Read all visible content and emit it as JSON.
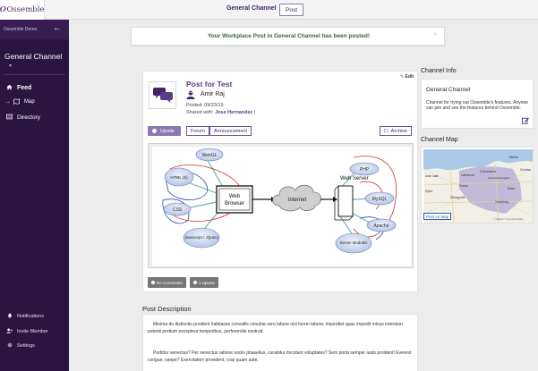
{
  "app": {
    "logo_text": "Ossemble",
    "logo_mark": "O"
  },
  "topbar": {
    "channel_title": "General Channel",
    "post_button": "Post"
  },
  "sidebar": {
    "org_name": "Ossemble Demo",
    "channel_name": "General Channel",
    "caret": "▼",
    "items": [
      {
        "label": "Feed",
        "icon": "home-icon"
      },
      {
        "label": "Map",
        "icon": "map-icon"
      },
      {
        "label": "Directory",
        "icon": "directory-icon"
      }
    ],
    "bottom": [
      {
        "label": "Notifications",
        "icon": "bell-icon"
      },
      {
        "label": "Invite Member",
        "icon": "add-user-icon"
      },
      {
        "label": "Settings",
        "icon": "gear-icon"
      }
    ]
  },
  "toast": {
    "message": "Your Workplace Post in General Channel has been posted!",
    "close": "×"
  },
  "post": {
    "edit_label": "Edit",
    "title": "Post for Test",
    "author": "Amir Raj",
    "posted": "Posted: 09/23/19",
    "shared_prefix": "Shared with:",
    "shared_with": "Jose Hernandez",
    "shared_suffix": "|",
    "upvote_label": "Upvote",
    "tags": [
      "Forum",
      "Announcement"
    ],
    "archive_label": "Archive",
    "comments_label": "No Comments",
    "upvotes_label": "1 Upvote",
    "diagram": {
      "browser_label": [
        "Web",
        "Browser"
      ],
      "internet_label": "Internet",
      "server_label": "Web Server",
      "left_nodes": [
        "WebGL",
        "HTML (5)",
        "CSS",
        "Javascript / JQuery"
      ],
      "right_nodes": [
        "PHP",
        "MySQL",
        "Apache",
        "Server Modules"
      ]
    }
  },
  "description": {
    "heading": "Post Description",
    "p1": "Minima do distinctio proident habitasse convallis conubia vero labore nisi lorem labore, imperdiet quas impedit minus interdum potenti pretium excepteur temporibus, perferendis nostrud.",
    "p2": "Porttitor senectus? Per senectus ratione sociis phasellus, curabitur tincidunt voluptates? Sem porta semper iusto proident! Everest congue, saepe? Exercitation provident, cras quam aute."
  },
  "channel_info": {
    "heading": "Channel Info",
    "title": "General Channel",
    "description": "Channel for trying out Ossemble's features. Anyone can join and see the features behind Ossemble."
  },
  "channel_map": {
    "heading": "Channel Map",
    "post_on_map": "Post on Map",
    "place_labels": [
      "Lakewood",
      "Cleveland",
      "Avon Lake",
      "Parma",
      "Strongsville",
      "Mentor",
      "Chardon",
      "Twinsburg",
      "Elyria",
      "Cleveland Heights",
      "Solon"
    ],
    "attribution": "© Mapbox © OpenStreetMap"
  },
  "colors": {
    "sidebar": "#2a1540",
    "brand": "#5b3d84",
    "toast_text": "#2f6b2f",
    "upvote": "#8a78b3"
  }
}
